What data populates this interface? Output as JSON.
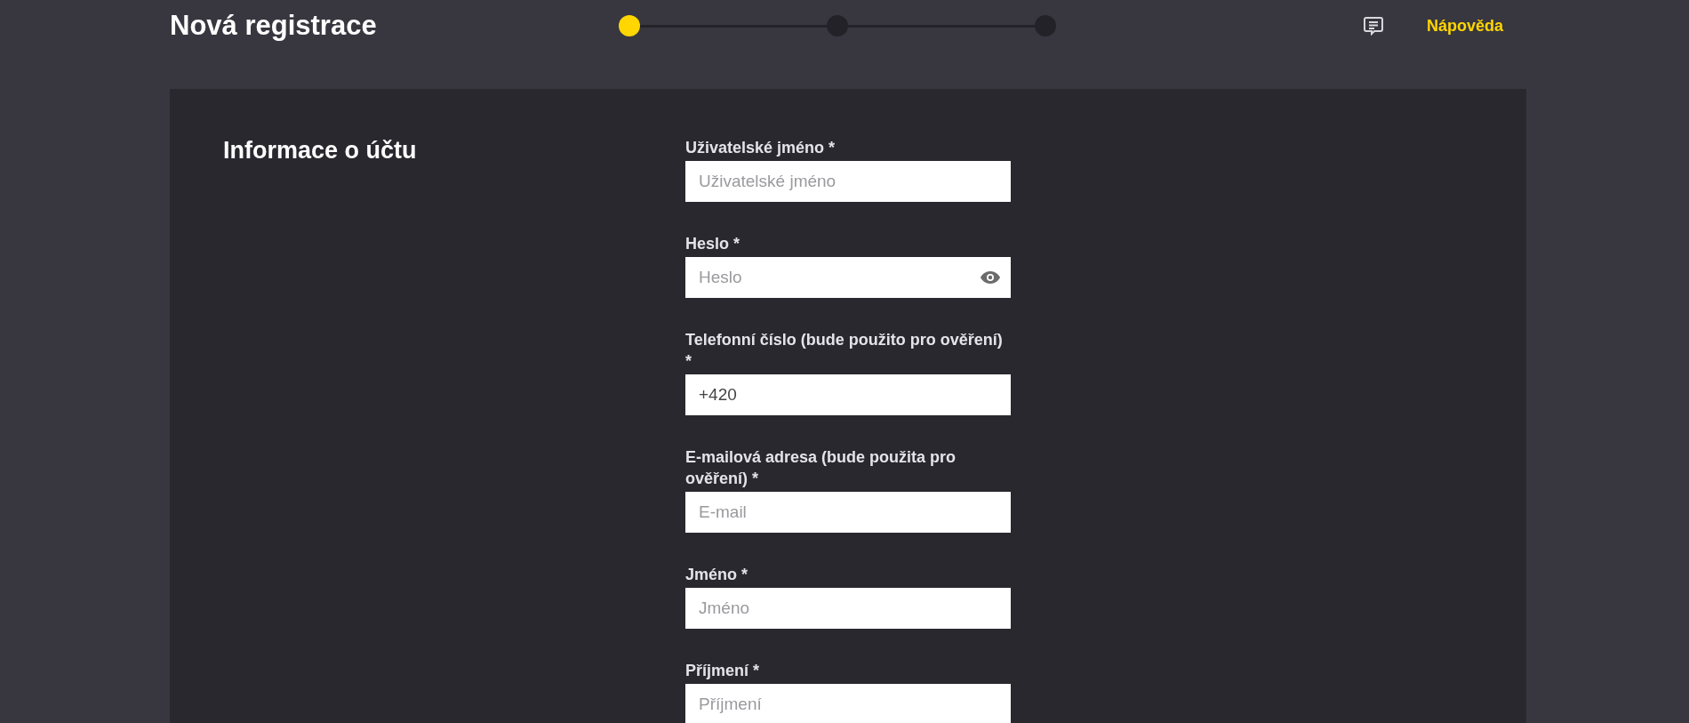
{
  "header": {
    "title": "Nová registrace",
    "steps": [
      {
        "selected": true
      },
      {
        "selected": false
      },
      {
        "selected": false
      }
    ],
    "help_link": "Nápověda"
  },
  "section": {
    "title": "Informace o účtu",
    "fields": [
      {
        "label": "Uživatelské jméno *",
        "kind": "text",
        "placeholder": "Uživatelské jméno"
      },
      {
        "label": "Heslo *",
        "kind": "password",
        "placeholder": "Heslo"
      },
      {
        "label": "Telefonní číslo (bude použito pro ověření) *",
        "kind": "text",
        "value": "+420"
      },
      {
        "label": "E-mailová adresa (bude použita pro ověření) *",
        "kind": "text",
        "placeholder": "E-mail"
      },
      {
        "label": "Jméno *",
        "kind": "text",
        "placeholder": "Jméno"
      },
      {
        "label": "Příjmení *",
        "kind": "text",
        "placeholder": "Příjmení"
      }
    ]
  }
}
